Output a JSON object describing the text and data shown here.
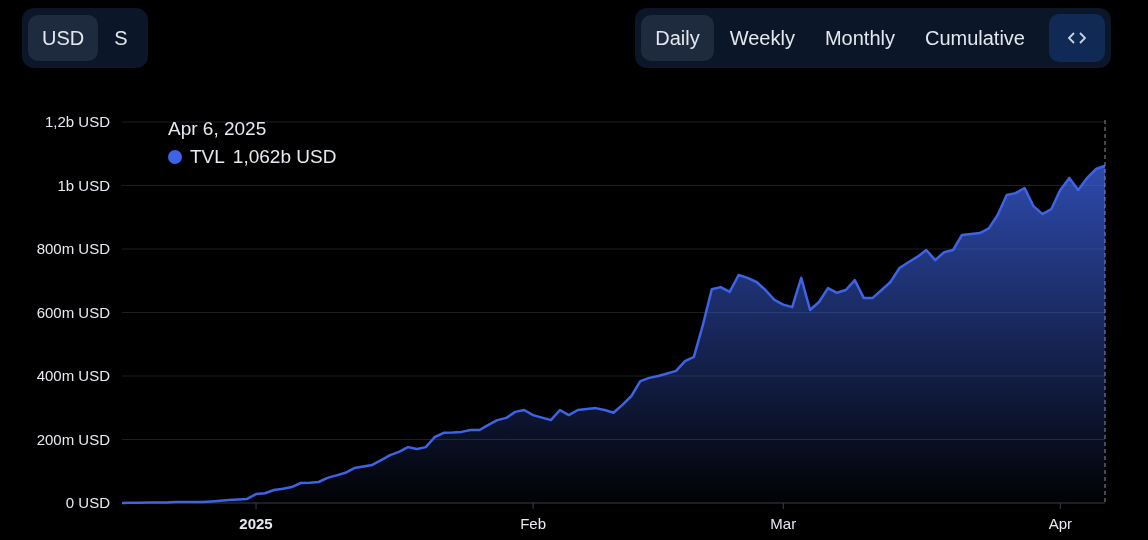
{
  "currency_tabs": [
    {
      "label": "USD",
      "selected": true
    },
    {
      "label": "S",
      "selected": false
    }
  ],
  "period_tabs": [
    {
      "label": "Daily",
      "selected": true
    },
    {
      "label": "Weekly",
      "selected": false
    },
    {
      "label": "Monthly",
      "selected": false
    },
    {
      "label": "Cumulative",
      "selected": false
    }
  ],
  "chart": {
    "tooltip": {
      "date": "Apr 6, 2025",
      "value": "1,062b USD"
    },
    "chart_data": {
      "type": "area",
      "grid": true,
      "ylim": [
        0,
        1200000000.0
      ],
      "yticks": [
        {
          "value": 0,
          "label": "0 USD"
        },
        {
          "value": 200000000.0,
          "label": "200m USD"
        },
        {
          "value": 400000000.0,
          "label": "400m USD"
        },
        {
          "value": 600000000.0,
          "label": "600m USD"
        },
        {
          "value": 800000000.0,
          "label": "800m USD"
        },
        {
          "value": 1000000000.0,
          "label": "1b USD"
        },
        {
          "value": 1200000000.0,
          "label": "1,2b USD"
        }
      ],
      "categories": [
        null,
        null,
        null,
        null,
        null,
        null,
        null,
        null,
        null,
        null,
        null,
        null,
        null,
        null,
        null,
        "2025",
        null,
        null,
        null,
        null,
        null,
        null,
        null,
        null,
        null,
        null,
        null,
        null,
        null,
        null,
        null,
        null,
        null,
        null,
        null,
        null,
        null,
        null,
        null,
        null,
        null,
        null,
        null,
        null,
        null,
        null,
        "Feb",
        null,
        null,
        null,
        null,
        null,
        null,
        null,
        null,
        null,
        null,
        null,
        null,
        null,
        null,
        null,
        null,
        null,
        null,
        null,
        null,
        null,
        null,
        null,
        null,
        null,
        null,
        null,
        "Mar",
        null,
        null,
        null,
        null,
        null,
        null,
        null,
        null,
        null,
        null,
        null,
        null,
        null,
        null,
        null,
        null,
        null,
        null,
        null,
        null,
        null,
        null,
        null,
        null,
        null,
        null,
        null,
        null,
        null,
        null,
        "Apr",
        null,
        null,
        null,
        null,
        null
      ],
      "series": [
        {
          "name": "TVL",
          "color": "#3d63e6",
          "values": [
            0,
            1000000.0,
            1000000.0,
            2000000.0,
            2000000.0,
            2000000.0,
            3000000.0,
            3000000.0,
            3000000.0,
            3000000.0,
            5000000.0,
            7000000.0,
            9000000.0,
            11000000.0,
            13000000.0,
            28000000.0,
            31000000.0,
            41000000.0,
            45000000.0,
            50000000.0,
            63000000.0,
            64000000.0,
            66000000.0,
            79000000.0,
            87000000.0,
            95000000.0,
            110000000.0,
            115000000.0,
            120000000.0,
            135000000.0,
            151000000.0,
            161000000.0,
            176000000.0,
            170000000.0,
            176000000.0,
            208000000.0,
            221000000.0,
            222000000.0,
            224000000.0,
            230000000.0,
            230000000.0,
            246000000.0,
            261000000.0,
            268000000.0,
            287000000.0,
            293000000.0,
            277000000.0,
            269000000.0,
            261000000.0,
            293000000.0,
            277000000.0,
            293000000.0,
            296000000.0,
            299000000.0,
            293000000.0,
            284000000.0,
            309000000.0,
            337000000.0,
            384000000.0,
            394000000.0,
            400000000.0,
            408000000.0,
            416000000.0,
            447000000.0,
            460000000.0,
            561000000.0,
            673000000.0,
            680000000.0,
            665000000.0,
            718000000.0,
            709000000.0,
            696000000.0,
            671000000.0,
            640000000.0,
            625000000.0,
            617000000.0,
            709000000.0,
            608000000.0,
            633000000.0,
            677000000.0,
            662000000.0,
            671000000.0,
            702000000.0,
            646000000.0,
            646000000.0,
            671000000.0,
            696000000.0,
            740000000.0,
            758000000.0,
            775000000.0,
            797000000.0,
            765000000.0,
            790000000.0,
            797000000.0,
            844000000.0,
            847000000.0,
            850000000.0,
            865000000.0,
            908000000.0,
            970000000.0,
            976000000.0,
            992000000.0,
            935000000.0,
            910000000.0,
            926000000.0,
            986000000.0,
            1024000000.0,
            986000000.0,
            1024000000.0,
            1052000000.0,
            1062000000.0
          ]
        }
      ]
    }
  }
}
